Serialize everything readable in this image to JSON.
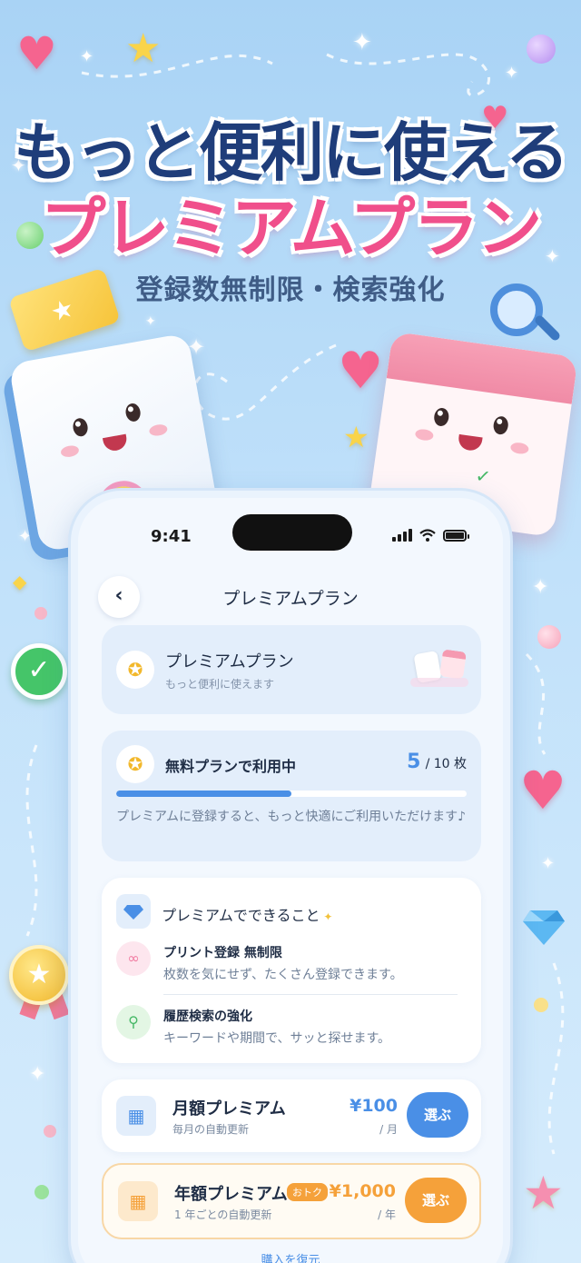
{
  "hero": {
    "title_line1": "もっと便利に使える",
    "title_line2": "プレミアムプラン",
    "subtitle": "登録数無制限・検索強化"
  },
  "status_bar": {
    "time": "9:41"
  },
  "nav": {
    "title": "プレミアムプラン",
    "back_icon": "chevron-left-icon"
  },
  "plan_header": {
    "title": "プレミアムプラン",
    "subtitle": "もっと便利に使えます",
    "icon": "medal-icon"
  },
  "usage": {
    "status": "無料プランで利用中",
    "used": "5",
    "limit": "/ 10 枚",
    "progress_fraction": 0.5,
    "description": "プレミアムに登録すると、もっと快適にご利用いただけます♪",
    "accent": "#4a8fe6"
  },
  "features": {
    "title": "プレミアムでできること",
    "items": [
      {
        "icon": "infinity-icon",
        "title": "プリント登録 無制限",
        "desc": "枚数を気にせず、たくさん登録できます。"
      },
      {
        "icon": "search-icon",
        "title": "履歴検索の強化",
        "desc": "キーワードや期間で、サッと探せます。"
      }
    ]
  },
  "plans": {
    "monthly": {
      "name": "月額プレミアム",
      "sub": "毎月の自動更新",
      "price": "¥100",
      "per": "/ 月",
      "button": "選ぶ",
      "color": "#4a8fe6"
    },
    "yearly": {
      "name": "年額プレミアム",
      "badge": "おトク",
      "sub": "1 年ごとの自動更新",
      "price": "¥1,000",
      "per": "/ 年",
      "button": "選ぶ",
      "color": "#f5a13a"
    }
  },
  "restore_label": "購入を復元"
}
